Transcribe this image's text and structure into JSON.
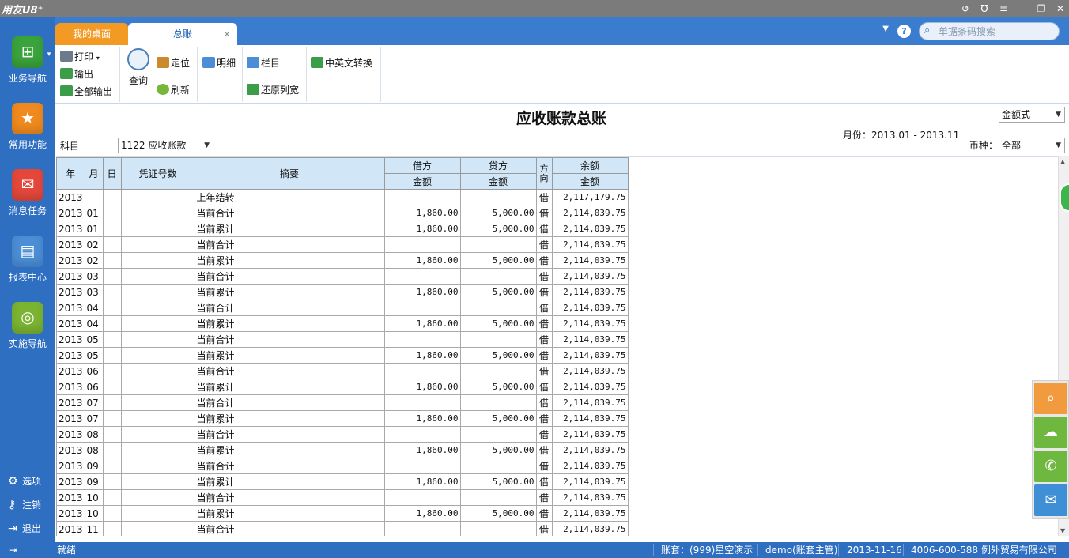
{
  "app": {
    "logo": "用友U8⁺"
  },
  "window_controls": [
    "↺",
    "Ʊ",
    "≡",
    "—",
    "❐",
    "✕"
  ],
  "nav": {
    "items": [
      {
        "label": "业务导航",
        "icon": "business-nav-icon",
        "color": "#3aa33b"
      },
      {
        "label": "常用功能",
        "icon": "star-icon",
        "color": "#f08a1e"
      },
      {
        "label": "消息任务",
        "icon": "message-icon",
        "color": "#e5483b"
      },
      {
        "label": "报表中心",
        "icon": "report-icon",
        "color": "#4b8ed6"
      },
      {
        "label": "实施导航",
        "icon": "compass-icon",
        "color": "#7bb432"
      }
    ],
    "bottom": [
      {
        "label": "选项",
        "icon": "gear-icon"
      },
      {
        "label": "注销",
        "icon": "key-icon"
      },
      {
        "label": "退出",
        "icon": "exit-icon"
      }
    ]
  },
  "tabs": [
    {
      "label": "我的桌面"
    },
    {
      "label": "总账",
      "close": "×"
    }
  ],
  "search": {
    "placeholder": "单据条码搜索"
  },
  "toolbar": {
    "print": "打印",
    "export": "输出",
    "export_all": "全部输出",
    "query": "查询",
    "locate": "定位",
    "refresh": "刷新",
    "detail": "明细",
    "columns": "栏目",
    "restore_width": "还原列宽",
    "lang_switch": "中英文转换"
  },
  "report": {
    "title": "应收账款总账",
    "format": "金额式",
    "subject_label": "科目",
    "subject_value": "1122 应收账款",
    "period_label": "月份：2013.01 - 2013.11",
    "currency_label": "币种：",
    "currency_value": "全部"
  },
  "table": {
    "headers": {
      "year": "年",
      "month": "月",
      "day": "日",
      "voucher": "凭证号数",
      "summary": "摘要",
      "debit": "借方",
      "credit": "贷方",
      "direction": "方向",
      "balance": "余额",
      "amount": "金额"
    },
    "rows": [
      [
        "2013",
        "",
        "",
        "",
        "上年结转",
        "",
        "",
        "借",
        "2,117,179.75"
      ],
      [
        "2013",
        "01",
        "",
        "",
        "当前合计",
        "1,860.00",
        "5,000.00",
        "借",
        "2,114,039.75"
      ],
      [
        "2013",
        "01",
        "",
        "",
        "当前累计",
        "1,860.00",
        "5,000.00",
        "借",
        "2,114,039.75"
      ],
      [
        "2013",
        "02",
        "",
        "",
        "当前合计",
        "",
        "",
        "借",
        "2,114,039.75"
      ],
      [
        "2013",
        "02",
        "",
        "",
        "当前累计",
        "1,860.00",
        "5,000.00",
        "借",
        "2,114,039.75"
      ],
      [
        "2013",
        "03",
        "",
        "",
        "当前合计",
        "",
        "",
        "借",
        "2,114,039.75"
      ],
      [
        "2013",
        "03",
        "",
        "",
        "当前累计",
        "1,860.00",
        "5,000.00",
        "借",
        "2,114,039.75"
      ],
      [
        "2013",
        "04",
        "",
        "",
        "当前合计",
        "",
        "",
        "借",
        "2,114,039.75"
      ],
      [
        "2013",
        "04",
        "",
        "",
        "当前累计",
        "1,860.00",
        "5,000.00",
        "借",
        "2,114,039.75"
      ],
      [
        "2013",
        "05",
        "",
        "",
        "当前合计",
        "",
        "",
        "借",
        "2,114,039.75"
      ],
      [
        "2013",
        "05",
        "",
        "",
        "当前累计",
        "1,860.00",
        "5,000.00",
        "借",
        "2,114,039.75"
      ],
      [
        "2013",
        "06",
        "",
        "",
        "当前合计",
        "",
        "",
        "借",
        "2,114,039.75"
      ],
      [
        "2013",
        "06",
        "",
        "",
        "当前累计",
        "1,860.00",
        "5,000.00",
        "借",
        "2,114,039.75"
      ],
      [
        "2013",
        "07",
        "",
        "",
        "当前合计",
        "",
        "",
        "借",
        "2,114,039.75"
      ],
      [
        "2013",
        "07",
        "",
        "",
        "当前累计",
        "1,860.00",
        "5,000.00",
        "借",
        "2,114,039.75"
      ],
      [
        "2013",
        "08",
        "",
        "",
        "当前合计",
        "",
        "",
        "借",
        "2,114,039.75"
      ],
      [
        "2013",
        "08",
        "",
        "",
        "当前累计",
        "1,860.00",
        "5,000.00",
        "借",
        "2,114,039.75"
      ],
      [
        "2013",
        "09",
        "",
        "",
        "当前合计",
        "",
        "",
        "借",
        "2,114,039.75"
      ],
      [
        "2013",
        "09",
        "",
        "",
        "当前累计",
        "1,860.00",
        "5,000.00",
        "借",
        "2,114,039.75"
      ],
      [
        "2013",
        "10",
        "",
        "",
        "当前合计",
        "",
        "",
        "借",
        "2,114,039.75"
      ],
      [
        "2013",
        "10",
        "",
        "",
        "当前累计",
        "1,860.00",
        "5,000.00",
        "借",
        "2,114,039.75"
      ],
      [
        "2013",
        "11",
        "",
        "",
        "当前合计",
        "",
        "",
        "借",
        "2,114,039.75"
      ]
    ]
  },
  "float_buttons": [
    {
      "icon": "search-icon",
      "color": "#f19a3e"
    },
    {
      "icon": "cloud-icon",
      "color": "#6fb83f"
    },
    {
      "icon": "chat-icon",
      "color": "#6fb83f"
    },
    {
      "icon": "inbox-icon",
      "color": "#3f8fd6"
    }
  ],
  "status": {
    "state": "就绪",
    "account": "账套：(999)星空演示",
    "user": "demo(账套主管)",
    "date": "2013-11-16",
    "company": "4006-600-588 例外贸易有限公司"
  }
}
